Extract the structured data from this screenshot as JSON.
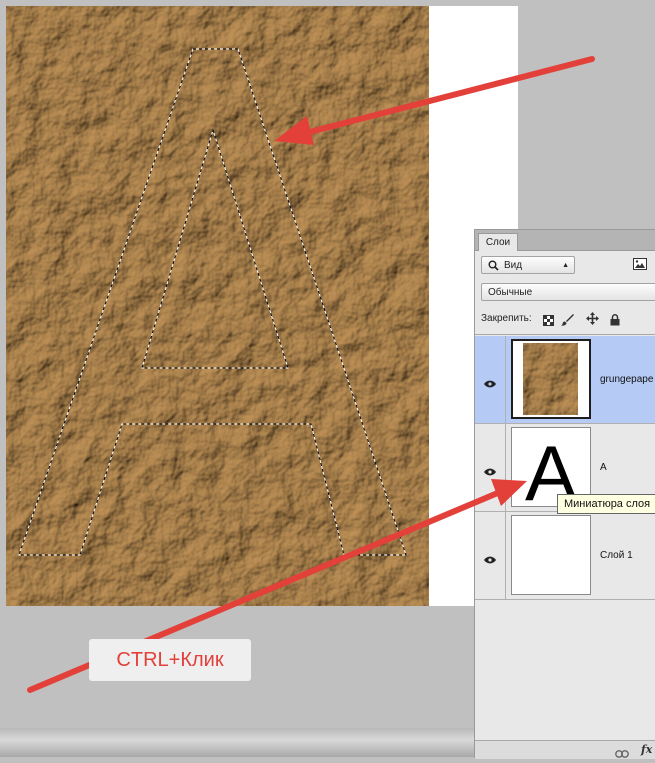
{
  "document": {
    "canvas_note": "",
    "hint_label": "CTRL+Клик"
  },
  "layers_panel": {
    "tab_label": "Слои",
    "filter_label": "Вид",
    "blend_mode": "Обычные",
    "lock_label": "Закрепить:",
    "layers": [
      {
        "name": "grungepape",
        "selected": true,
        "thumb": "paper"
      },
      {
        "name": "А",
        "selected": false,
        "thumb": "letter"
      },
      {
        "name": "Слой 1",
        "selected": false,
        "thumb": "white"
      }
    ],
    "tooltip": "Миниатюра слоя",
    "thumb_letter": "A"
  },
  "icons": [
    "search-icon",
    "image-filter-icon",
    "lock-pixels-icon",
    "brush-icon",
    "move-icon",
    "lock-icon",
    "eye-icon",
    "link-icon",
    "fx-icon"
  ],
  "colors": {
    "arrow": "#e3403a",
    "selected_layer": "#b5caf5",
    "paper": "#b0864f"
  }
}
